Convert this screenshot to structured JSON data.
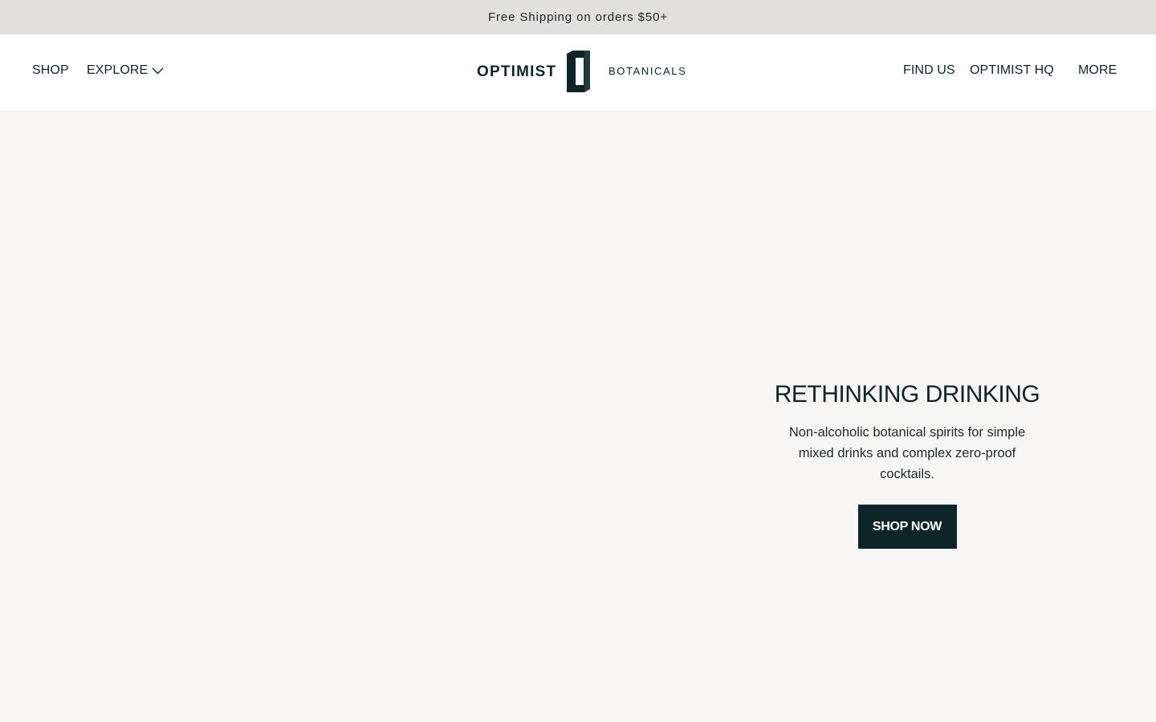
{
  "announcement": {
    "text": "Free Shipping on orders $50+"
  },
  "header": {
    "nav_left": [
      {
        "label": "SHOP"
      },
      {
        "label": "EXPLORE",
        "icon": "chevron-down-icon"
      }
    ],
    "logo": {
      "wordmark": "OPTIMIST",
      "subtitle": "BOTANICALS",
      "mark": "O"
    },
    "nav_right": [
      {
        "label": "FIND US"
      },
      {
        "label": "OPTIMIST HQ"
      },
      {
        "label": "MORE"
      }
    ]
  },
  "hero": {
    "title": "RETHINKING DRINKING",
    "description": "Non-alcoholic botanical spirits for simple mixed drinks and complex zero-proof cocktails.",
    "cta_label": "SHOP NOW"
  },
  "colors": {
    "announcement_bg": "#e1e0de",
    "header_bg": "#ffffff",
    "hero_bg": "#f7f6f4",
    "brand_dark": "#0d2529"
  }
}
